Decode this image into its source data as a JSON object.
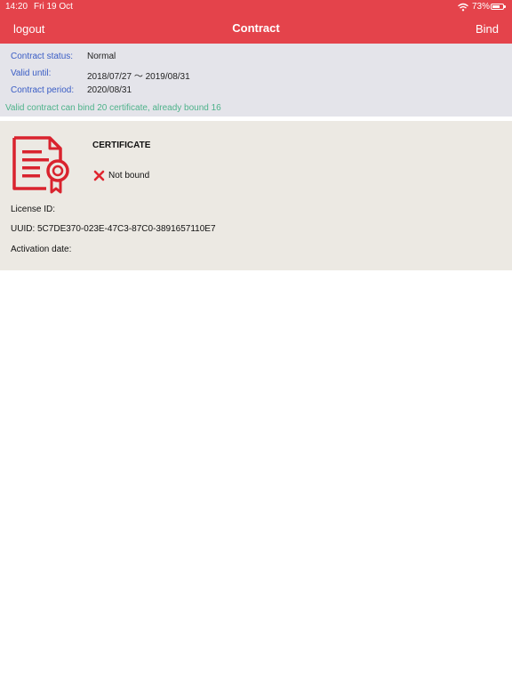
{
  "status_bar": {
    "time": "14:20",
    "date": "Fri 19 Oct",
    "battery_percent": "73%",
    "battery_level": 0.73,
    "wifi_icon": "wifi-icon",
    "battery_icon": "battery-icon"
  },
  "nav": {
    "logout_label": "logout",
    "title": "Contract",
    "bind_label": "Bind"
  },
  "contract": {
    "status_label": "Contract status:",
    "status_value": "Normal",
    "valid_label": "Valid until:",
    "valid_value": "2018/07/27 ～ 2019/08/31",
    "period_label": "Contract period:",
    "period_value": "2020/08/31",
    "bind_info": "Valid contract can bind 20 certificate, already bound 16"
  },
  "certificate": {
    "icon": "certificate-icon",
    "title": "CERTIFICATE",
    "status_icon": "close-icon",
    "status_text": "Not bound",
    "license_id": "License ID:",
    "uuid": "UUID: 5C7DE370-023E-47C3-87C0-3891657110E7",
    "activation_date": "Activation date:"
  },
  "colors": {
    "accent": "#e4434b",
    "label_blue": "#3a5dc5",
    "info_green": "#4eb28a",
    "panel_gray": "#e4e4ea",
    "card_beige": "#ece9e3",
    "icon_red": "#d9232e"
  }
}
